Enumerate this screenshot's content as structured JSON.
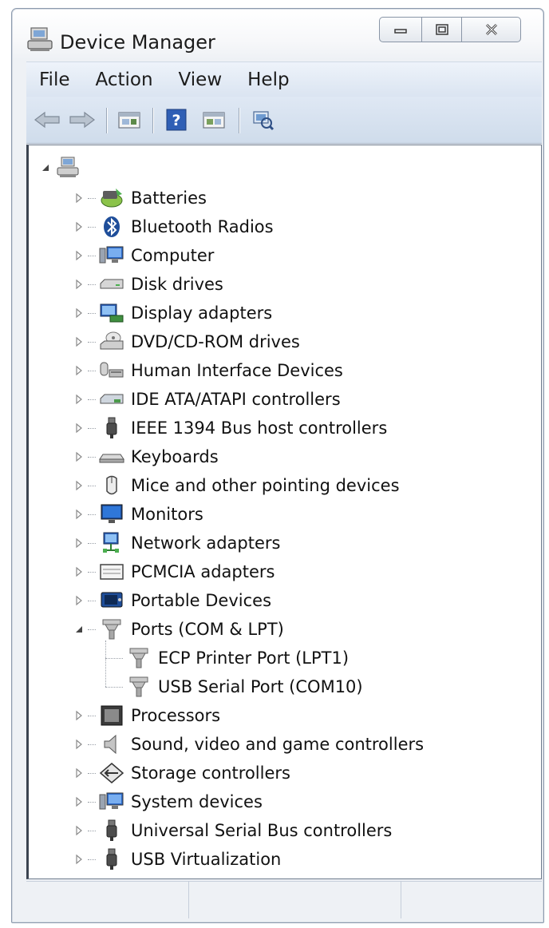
{
  "window": {
    "title": "Device Manager"
  },
  "caption_buttons": {
    "minimize": "minimize-icon",
    "maximize": "maximize-icon",
    "close": "close-icon"
  },
  "menu": [
    "File",
    "Action",
    "View",
    "Help"
  ],
  "toolbar": [
    "back-arrow-icon",
    "forward-arrow-icon",
    "properties-icon",
    "help-icon",
    "update-driver-icon",
    "scan-hardware-icon"
  ],
  "tree": {
    "root_icon": "computer-root-icon",
    "categories": [
      {
        "label": "Batteries",
        "icon": "battery-icon",
        "expanded": false
      },
      {
        "label": "Bluetooth Radios",
        "icon": "bluetooth-icon",
        "expanded": false
      },
      {
        "label": "Computer",
        "icon": "computer-icon",
        "expanded": false
      },
      {
        "label": "Disk drives",
        "icon": "disk-drive-icon",
        "expanded": false
      },
      {
        "label": "Display adapters",
        "icon": "display-adapter-icon",
        "expanded": false
      },
      {
        "label": "DVD/CD-ROM drives",
        "icon": "dvd-drive-icon",
        "expanded": false
      },
      {
        "label": "Human Interface Devices",
        "icon": "hid-icon",
        "expanded": false
      },
      {
        "label": "IDE ATA/ATAPI controllers",
        "icon": "ide-controller-icon",
        "expanded": false
      },
      {
        "label": "IEEE 1394 Bus host controllers",
        "icon": "ieee1394-icon",
        "expanded": false
      },
      {
        "label": "Keyboards",
        "icon": "keyboard-icon",
        "expanded": false
      },
      {
        "label": "Mice and other pointing devices",
        "icon": "mouse-icon",
        "expanded": false
      },
      {
        "label": "Monitors",
        "icon": "monitor-icon",
        "expanded": false
      },
      {
        "label": "Network adapters",
        "icon": "network-adapter-icon",
        "expanded": false
      },
      {
        "label": "PCMCIA adapters",
        "icon": "pcmcia-icon",
        "expanded": false
      },
      {
        "label": "Portable Devices",
        "icon": "portable-device-icon",
        "expanded": false
      },
      {
        "label": "Ports (COM & LPT)",
        "icon": "port-icon",
        "expanded": true,
        "children": [
          {
            "label": "ECP Printer Port (LPT1)",
            "icon": "port-icon"
          },
          {
            "label": "USB Serial Port (COM10)",
            "icon": "port-icon"
          }
        ]
      },
      {
        "label": "Processors",
        "icon": "processor-icon",
        "expanded": false
      },
      {
        "label": "Sound, video and game controllers",
        "icon": "speaker-icon",
        "expanded": false
      },
      {
        "label": "Storage controllers",
        "icon": "storage-controller-icon",
        "expanded": false
      },
      {
        "label": "System devices",
        "icon": "system-device-icon",
        "expanded": false
      },
      {
        "label": "Universal Serial Bus controllers",
        "icon": "usb-icon",
        "expanded": false
      },
      {
        "label": "USB Virtualization",
        "icon": "usb-icon",
        "expanded": false
      }
    ]
  },
  "status_bar": [
    "",
    "",
    ""
  ]
}
